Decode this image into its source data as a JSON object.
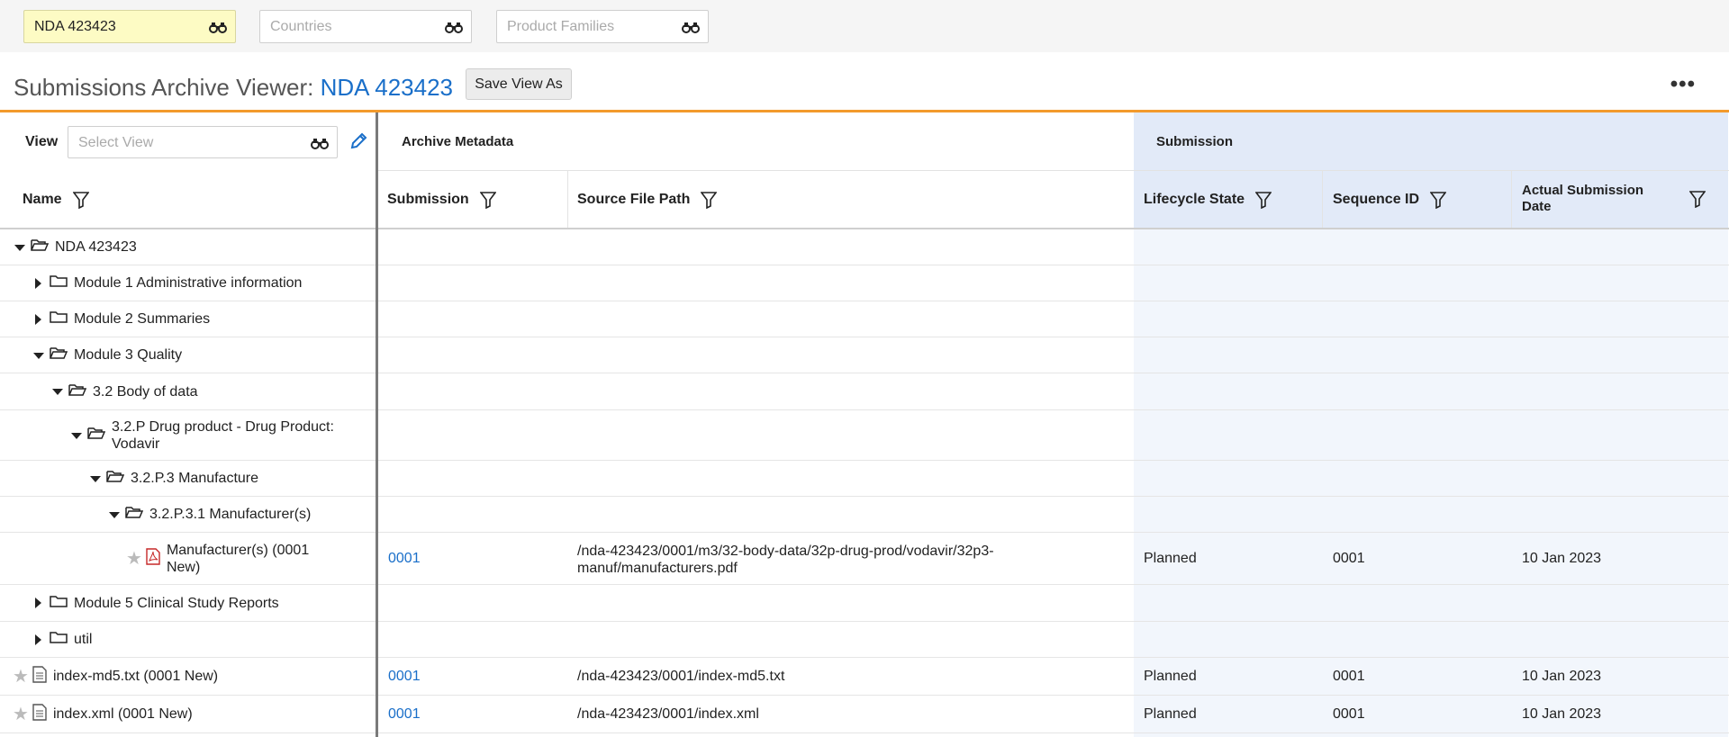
{
  "filters": {
    "application": "NDA 423423",
    "countries_placeholder": "Countries",
    "product_families_placeholder": "Product Families"
  },
  "page": {
    "title_prefix": "Submissions Archive Viewer: ",
    "title_nda": "NDA 423423",
    "save_view_as": "Save View As",
    "more_menu": "•••"
  },
  "view": {
    "label": "View",
    "placeholder": "Select View"
  },
  "groups": {
    "archive_metadata": "Archive Metadata",
    "submission": "Submission"
  },
  "columns": {
    "name": "Name",
    "submission": "Submission",
    "source_file_path": "Source File Path",
    "lifecycle_state": "Lifecycle State",
    "sequence_id": "Sequence ID",
    "actual_submission_date": "Actual Submission Date"
  },
  "rows": [
    {
      "label": "NDA 423423",
      "caret": "down",
      "icon": "folder-open"
    },
    {
      "label": "Module 1 Administrative information",
      "caret": "right",
      "icon": "folder"
    },
    {
      "label": "Module 2 Summaries",
      "caret": "right",
      "icon": "folder"
    },
    {
      "label": "Module 3 Quality",
      "caret": "down",
      "icon": "folder-open"
    },
    {
      "label": "3.2 Body of data",
      "caret": "down",
      "icon": "folder-open"
    },
    {
      "label": "3.2.P Drug product - Drug Product: Vodavir",
      "caret": "down",
      "icon": "folder-open"
    },
    {
      "label": "3.2.P.3 Manufacture",
      "caret": "down",
      "icon": "folder-open"
    },
    {
      "label": "3.2.P.3.1 Manufacturer(s)",
      "caret": "down",
      "icon": "folder-open"
    },
    {
      "label": "Manufacturer(s) (0001 New)",
      "icon": "pdf",
      "star": true,
      "submission": "0001",
      "path": "/nda-423423/0001/m3/32-body-data/32p-drug-prod/vodavir/32p3-manuf/manufacturers.pdf",
      "lifecycle": "Planned",
      "sequence": "0001",
      "date": "10 Jan 2023"
    },
    {
      "label": "Module 5 Clinical Study Reports",
      "caret": "right",
      "icon": "folder"
    },
    {
      "label": "util",
      "caret": "right",
      "icon": "folder"
    },
    {
      "label": "index-md5.txt (0001 New)",
      "icon": "doc",
      "star": true,
      "submission": "0001",
      "path": "/nda-423423/0001/index-md5.txt",
      "lifecycle": "Planned",
      "sequence": "0001",
      "date": "10 Jan 2023"
    },
    {
      "label": "index.xml (0001 New)",
      "icon": "doc",
      "star": true,
      "submission": "0001",
      "path": "/nda-423423/0001/index.xml",
      "lifecycle": "Planned",
      "sequence": "0001",
      "date": "10 Jan 2023"
    }
  ]
}
